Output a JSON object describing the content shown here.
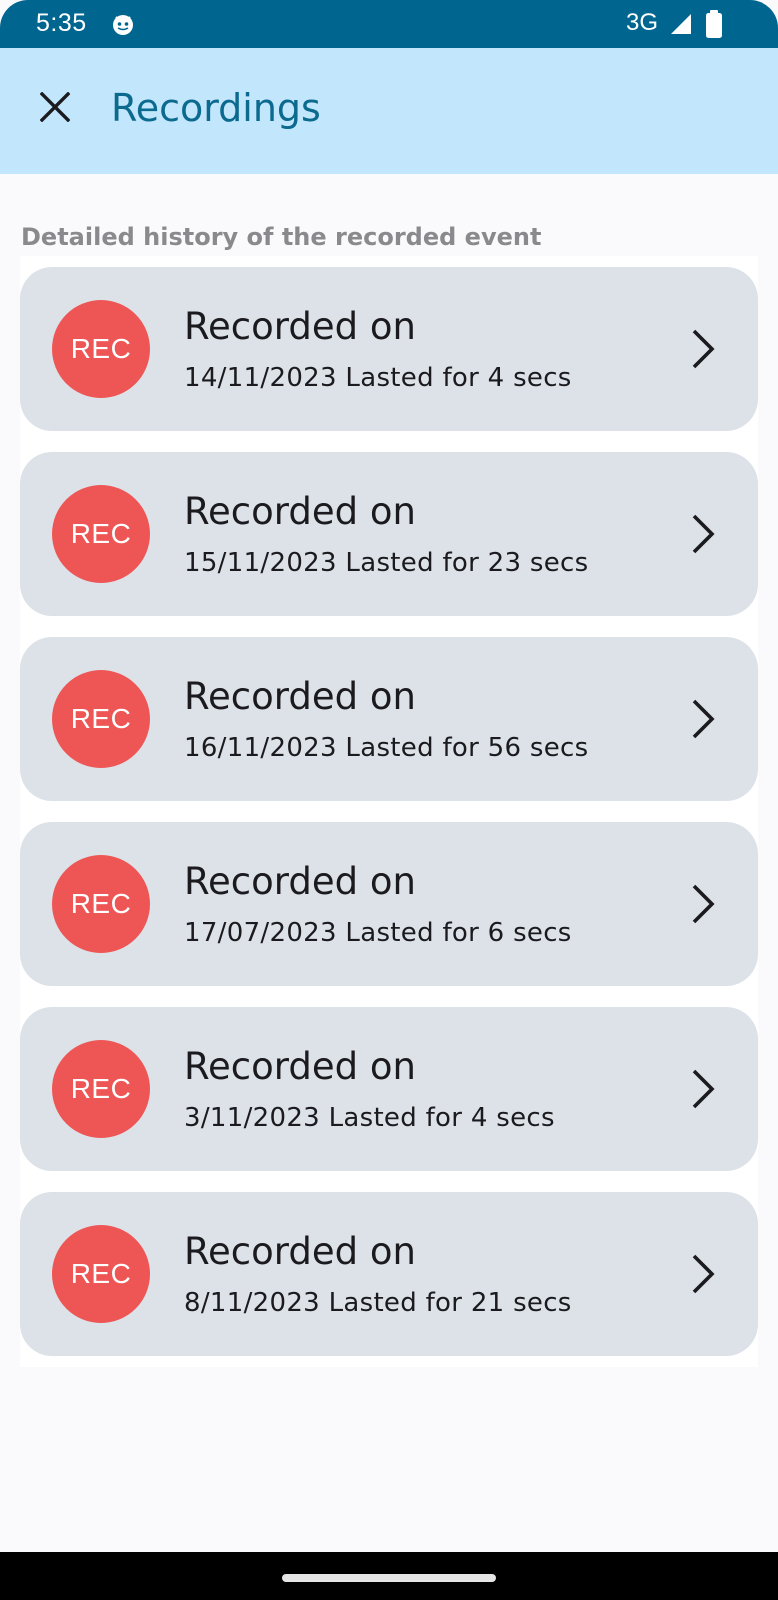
{
  "status_bar": {
    "time": "5:35",
    "network": "3G",
    "app_icon": "android-app-icon",
    "signal_icon": "cell-signal-icon",
    "battery_icon": "battery-icon"
  },
  "app_bar": {
    "close_icon": "close-icon",
    "title": "Recordings",
    "background_color": "#c2e6fc",
    "title_color": "#0b6a8e"
  },
  "subtitle": "Detailed history of the recorded event",
  "recordings": [
    {
      "badge": "REC",
      "title": "Recorded on",
      "detail": "14/11/2023 Lasted for 4 secs"
    },
    {
      "badge": "REC",
      "title": "Recorded on",
      "detail": "15/11/2023 Lasted for 23 secs"
    },
    {
      "badge": "REC",
      "title": "Recorded on",
      "detail": "16/11/2023 Lasted for 56 secs"
    },
    {
      "badge": "REC",
      "title": "Recorded on",
      "detail": "17/07/2023 Lasted for 6 secs"
    },
    {
      "badge": "REC",
      "title": "Recorded on",
      "detail": "3/11/2023 Lasted for 4 secs"
    },
    {
      "badge": "REC",
      "title": "Recorded on",
      "detail": "8/11/2023 Lasted for 21 secs"
    }
  ],
  "colors": {
    "status_bar": "#00658f",
    "card_background": "#dce2e7",
    "rec_badge": "#ee5656"
  },
  "nav_bar": {
    "handle_icon": "gesture-handle"
  }
}
